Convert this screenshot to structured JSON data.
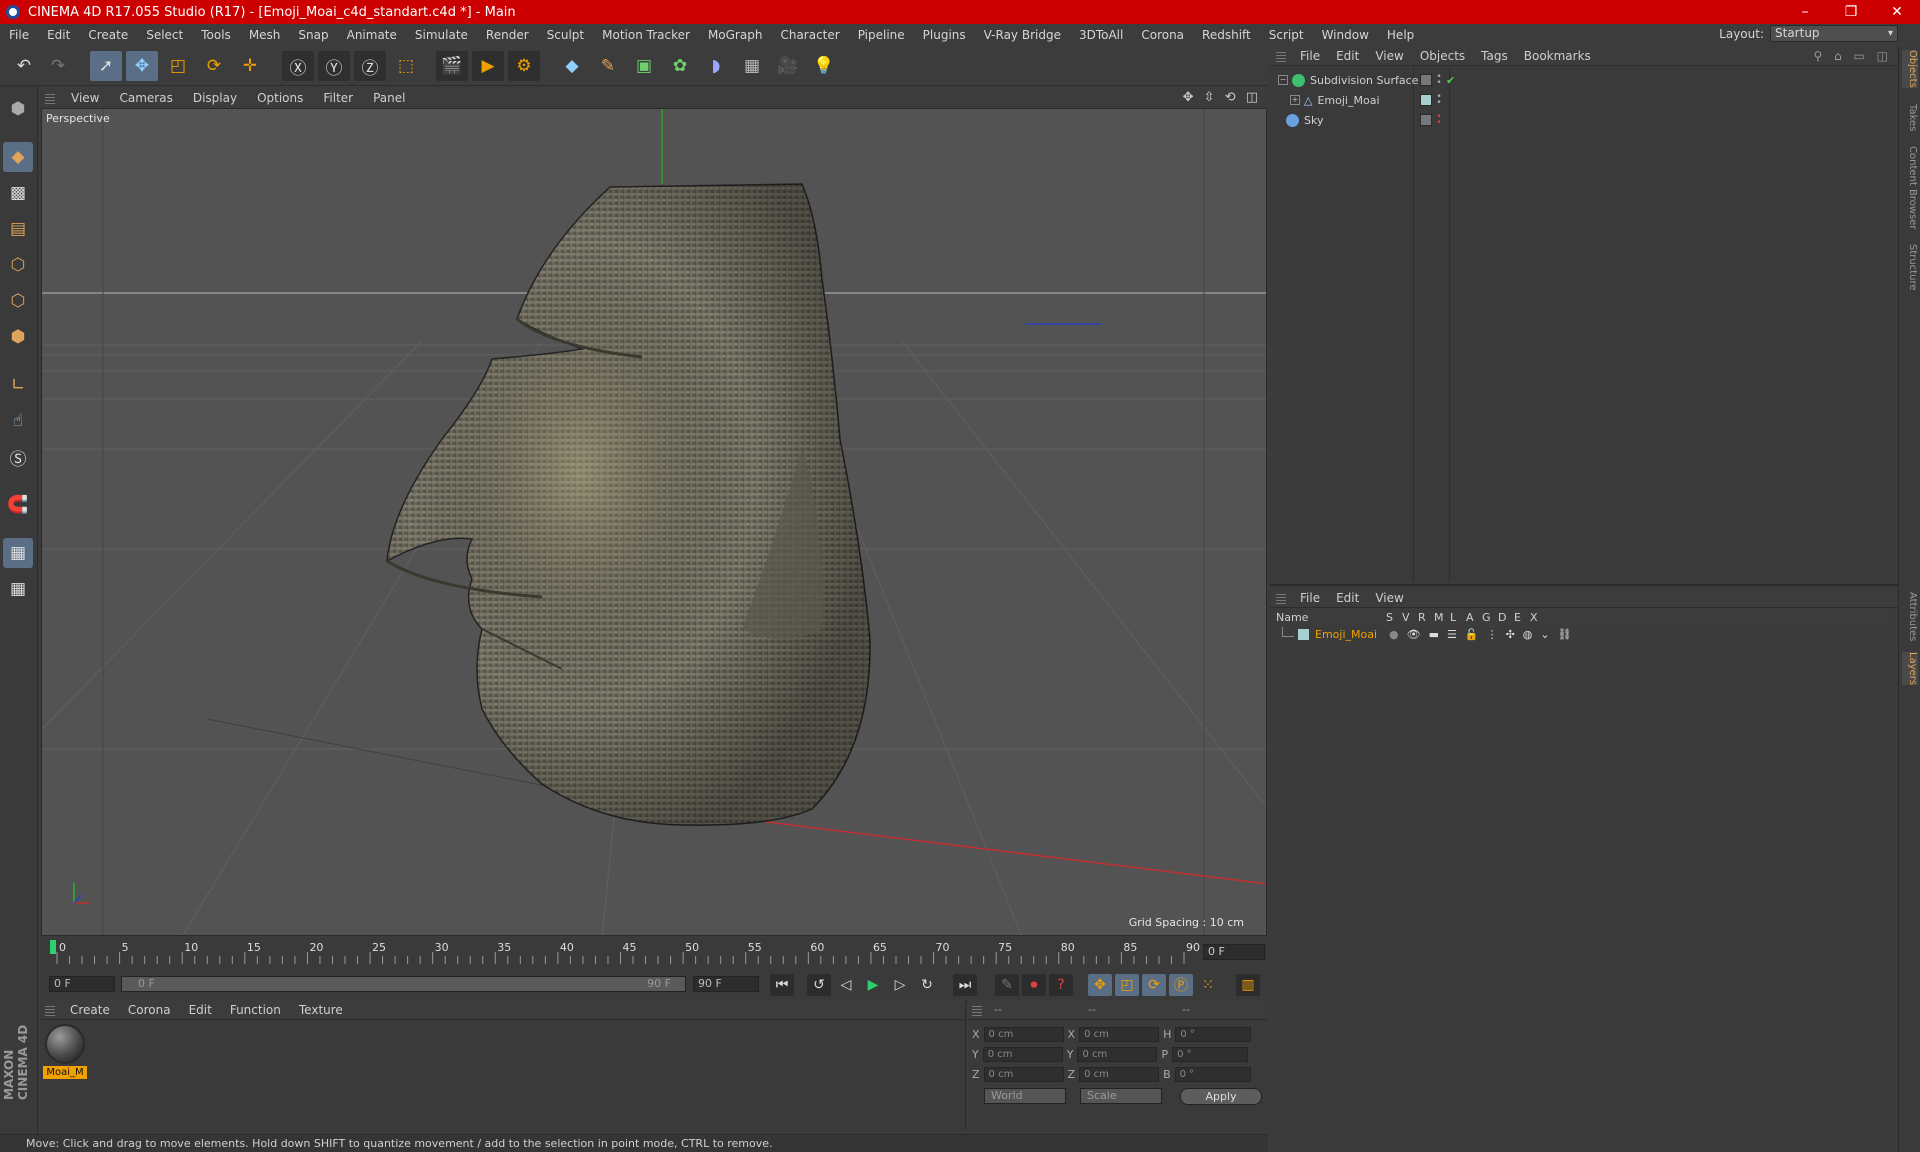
{
  "window": {
    "title": "CINEMA 4D R17.055 Studio (R17) - [Emoji_Moai_c4d_standart.c4d *] - Main",
    "controls": [
      "–",
      "❐",
      "✕"
    ]
  },
  "menu": [
    "File",
    "Edit",
    "Create",
    "Select",
    "Tools",
    "Mesh",
    "Snap",
    "Animate",
    "Simulate",
    "Render",
    "Sculpt",
    "Motion Tracker",
    "MoGraph",
    "Character",
    "Pipeline",
    "Plugins",
    "V-Ray Bridge",
    "3DToAll",
    "Corona",
    "Redshift",
    "Script",
    "Window",
    "Help"
  ],
  "layout": {
    "label": "Layout:",
    "value": "Startup"
  },
  "viewport": {
    "menu": [
      "View",
      "Cameras",
      "Display",
      "Options",
      "Filter",
      "Panel"
    ],
    "camera_label": "Perspective",
    "grid_spacing": "Grid Spacing : 10 cm",
    "nav_icons": "✥ ⇳ ⟲ ◫"
  },
  "timeline": {
    "ticks": [
      "0",
      "5",
      "10",
      "15",
      "20",
      "25",
      "30",
      "35",
      "40",
      "45",
      "50",
      "55",
      "60",
      "65",
      "70",
      "75",
      "80",
      "85",
      "90"
    ],
    "current_frame": "0 F"
  },
  "transport": {
    "start": "0 F",
    "slider_start": "0 F",
    "slider_end": "90 F",
    "end": "90 F"
  },
  "material_panel": {
    "menu": [
      "Create",
      "Corona",
      "Edit",
      "Function",
      "Texture"
    ],
    "material_name": "Moai_M"
  },
  "coord_panel": {
    "header": [
      "--",
      "--",
      "--"
    ],
    "rows": [
      {
        "a": "X",
        "v1": "0 cm",
        "b": "X",
        "v2": "0 cm",
        "c": "H",
        "v3": "0 °"
      },
      {
        "a": "Y",
        "v1": "0 cm",
        "b": "Y",
        "v2": "0 cm",
        "c": "P",
        "v3": "0 °"
      },
      {
        "a": "Z",
        "v1": "0 cm",
        "b": "Z",
        "v2": "0 cm",
        "c": "B",
        "v3": "0 °"
      }
    ],
    "world": "World",
    "scale": "Scale",
    "apply": "Apply"
  },
  "status": "Move: Click and drag to move elements. Hold down SHIFT to quantize movement / add to the selection in point mode, CTRL to remove.",
  "object_manager": {
    "menu": [
      "File",
      "Edit",
      "View",
      "Objects",
      "Tags",
      "Bookmarks"
    ],
    "objects": [
      "Subdivision Surface",
      "Emoji_Moai",
      "Sky"
    ]
  },
  "layer_manager": {
    "menu": [
      "File",
      "Edit",
      "View"
    ],
    "columns": [
      "Name",
      "S",
      "V",
      "R",
      "M",
      "L",
      "A",
      "G",
      "D",
      "E",
      "X"
    ],
    "layer_name": "Emoji_Moai"
  },
  "side_tabs": [
    "Objects",
    "Takes",
    "Content Browser",
    "Structure",
    "Attributes",
    "Layers"
  ],
  "branding": "MAXON CINEMA 4D"
}
